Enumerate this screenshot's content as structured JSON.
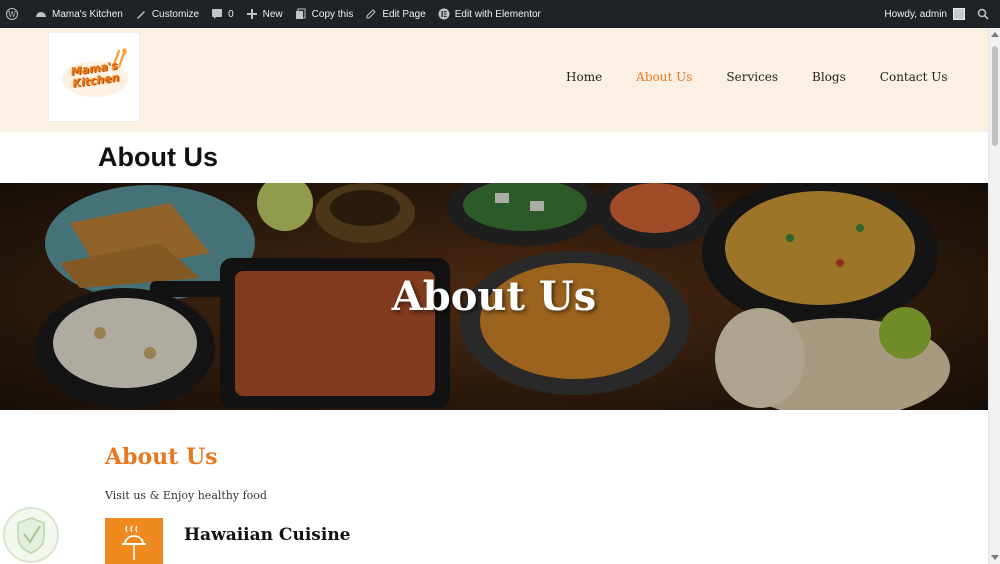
{
  "adminbar": {
    "site_name": "Mama's Kitchen",
    "customize": "Customize",
    "comments_count": "0",
    "new": "New",
    "copy_this": "Copy this",
    "edit_page": "Edit Page",
    "edit_with_elementor": "Edit with Elementor",
    "howdy": "Howdy, admin"
  },
  "header": {
    "logo_text_line1": "Mama's",
    "logo_text_line2": "Kitchen",
    "nav": [
      {
        "label": "Home",
        "active": false
      },
      {
        "label": "About Us",
        "active": true
      },
      {
        "label": "Services",
        "active": false
      },
      {
        "label": "Blogs",
        "active": false
      },
      {
        "label": "Contact Us",
        "active": false
      }
    ]
  },
  "page_title": "About Us",
  "hero": {
    "title": "About Us"
  },
  "content": {
    "heading": "About Us",
    "subheading": "Visit us & Enjoy healthy food",
    "feature_title": "Hawaiian Cuisine"
  },
  "colors": {
    "accent": "#e8781e",
    "admin_bar": "#1d2327",
    "header_bg": "#fbf0e3"
  }
}
